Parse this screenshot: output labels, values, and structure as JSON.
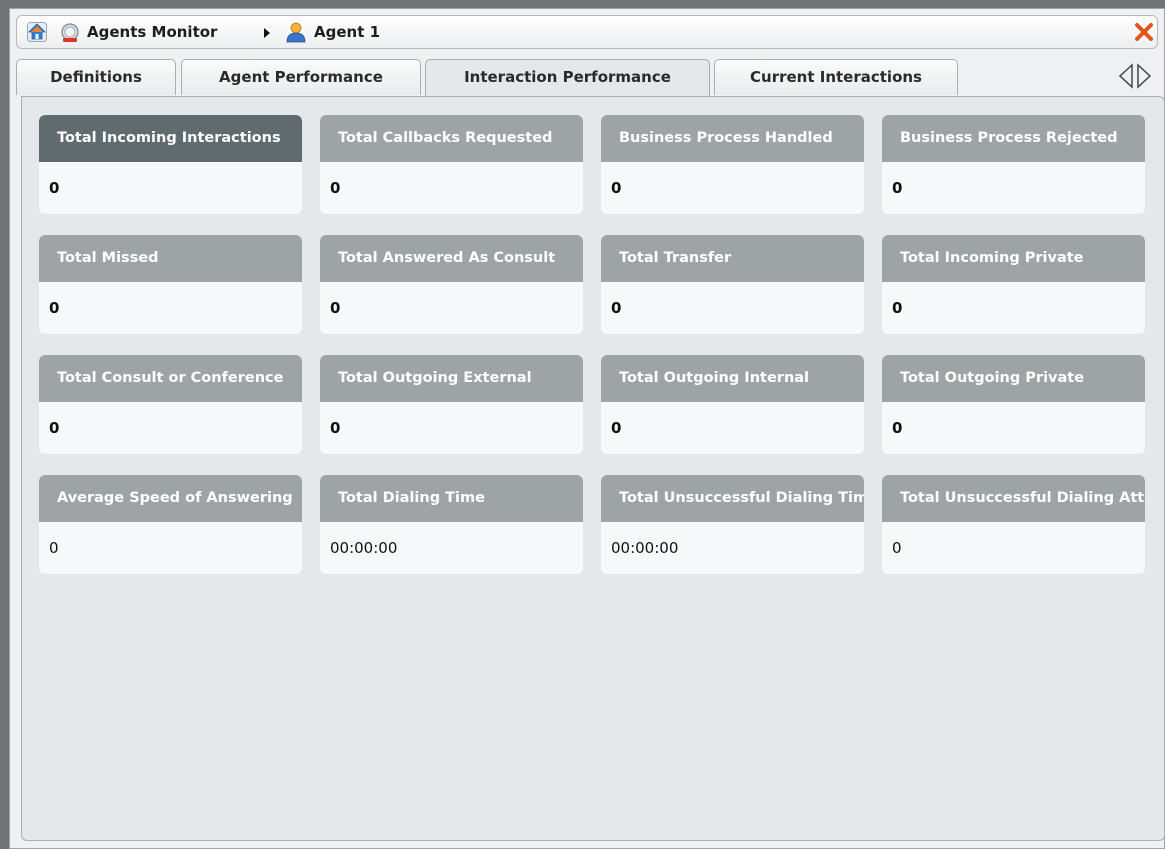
{
  "header": {
    "breadcrumb_root": "Agents Monitor",
    "breadcrumb_current": "Agent 1"
  },
  "tabs": [
    {
      "label": "Definitions",
      "active": false
    },
    {
      "label": "Agent Performance",
      "active": false
    },
    {
      "label": "Interaction Performance",
      "active": true
    },
    {
      "label": "Current Interactions",
      "active": false
    }
  ],
  "metrics": [
    {
      "label": "Total Incoming Interactions",
      "value": "0",
      "selected": true
    },
    {
      "label": "Total Callbacks Requested",
      "value": "0"
    },
    {
      "label": "Business Process Handled",
      "value": "0"
    },
    {
      "label": "Business Process Rejected",
      "value": "0"
    },
    {
      "label": "Total Missed",
      "value": "0"
    },
    {
      "label": "Total Answered As Consult",
      "value": "0"
    },
    {
      "label": "Total Transfer",
      "value": "0"
    },
    {
      "label": "Total Incoming Private",
      "value": "0"
    },
    {
      "label": "Total Consult or Conference",
      "value": "0"
    },
    {
      "label": "Total Outgoing External",
      "value": "0"
    },
    {
      "label": "Total Outgoing Internal",
      "value": "0"
    },
    {
      "label": "Total Outgoing Private",
      "value": "0"
    },
    {
      "label": "Average Speed of Answering",
      "value": "0"
    },
    {
      "label": "Total Dialing Time",
      "value": "00:00:00"
    },
    {
      "label": "Total Unsuccessful Dialing Time",
      "value": "00:00:00"
    },
    {
      "label": "Total Unsuccessful Dialing Attempts",
      "value": "0"
    }
  ],
  "colors": {
    "card_header": "#9ea4a6",
    "card_header_selected": "#5f6b6f",
    "close": "#e2541b"
  }
}
